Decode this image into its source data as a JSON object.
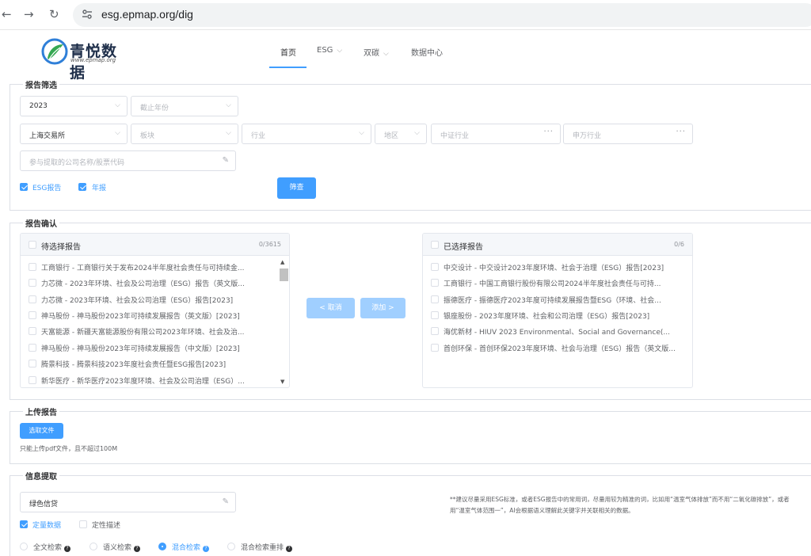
{
  "browser": {
    "url": "esg.epmap.org/dig"
  },
  "logo": {
    "brand": "青悦数据",
    "sub": "www.epmap.org"
  },
  "nav": {
    "items": [
      "首页",
      "ESG",
      "双碳",
      "数据中心"
    ]
  },
  "filter": {
    "legend": "报告筛选",
    "year": "2023",
    "end_year_placeholder": "截止年份",
    "exchange": "上海交易所",
    "board_placeholder": "板块",
    "industry_placeholder": "行业",
    "region_placeholder": "地区",
    "csi_placeholder": "中证行业",
    "sw_placeholder": "申万行业",
    "company_placeholder": "参与提取的公司名称/股票代码",
    "esg_label": "ESG报告",
    "annual_label": "年报",
    "search_button": "筛查"
  },
  "confirm": {
    "legend": "报告确认",
    "left_title": "待选择报告",
    "left_count": "0/3615",
    "left_items": [
      "工商银行 - 工商银行关于发布2024半年度社会责任与可持续金...",
      "力芯微 - 2023年环境、社会及公司治理（ESG）报告（英文版...",
      "力芯微 - 2023年环境、社会及公司治理（ESG）报告[2023]",
      "神马股份 - 神马股份2023年可持续发展报告（英文版）[2023]",
      "天富能源 - 新疆天富能源股份有限公司2023年环境、社会及治...",
      "神马股份 - 神马股份2023年可持续发展报告（中文版）[2023]",
      "腾景科技 - 腾景科技2023年度社会责任暨ESG报告[2023]",
      "新华医疗 - 新华医疗2023年度环境、社会及公司治理（ESG）..."
    ],
    "cancel_button": "< 取消",
    "add_button": "添加 >",
    "right_title": "已选择报告",
    "right_count": "0/6",
    "right_items": [
      "中交设计 - 中交设计2023年度环境、社会于治理（ESG）报告[2023]",
      "工商银行 - 中国工商银行股份有限公司2024半年度社会责任与可持...",
      "振德医疗 - 振德医疗2023年度可持续发展报告暨ESG（环境、社会...",
      "银座股份 - 2023年度环境、社会和公司治理（ESG）报告[2023]",
      "海优新材 - HIUV 2023 Environmental、Social and Governance(...",
      "首创环保 - 首创环保2023年度环境、社会与治理（ESG）报告（英文版..."
    ]
  },
  "upload": {
    "legend": "上传报告",
    "button": "选取文件",
    "hint": "只能上传pdf文件，且不超过100M"
  },
  "extract": {
    "legend": "信息提取",
    "keyword": "绿色信贷",
    "quant_label": "定量数据",
    "qual_label": "定性描述",
    "radios": [
      "全文检索",
      "语义检索",
      "混合检索",
      "混合检索重排"
    ],
    "selected_radio": 2,
    "note": "**建议尽量采用ESG标准，或者ESG报告中的常用词，尽量用较为精准的词，比如用“温室气体排放”而不用“二氧化碳排放”，或者用“温室气体范围一”，AI会根据语义理解此关键字并关联相关的数据。"
  },
  "colors": {
    "accent": "#409eff",
    "accent_light": "#a0cfff"
  }
}
